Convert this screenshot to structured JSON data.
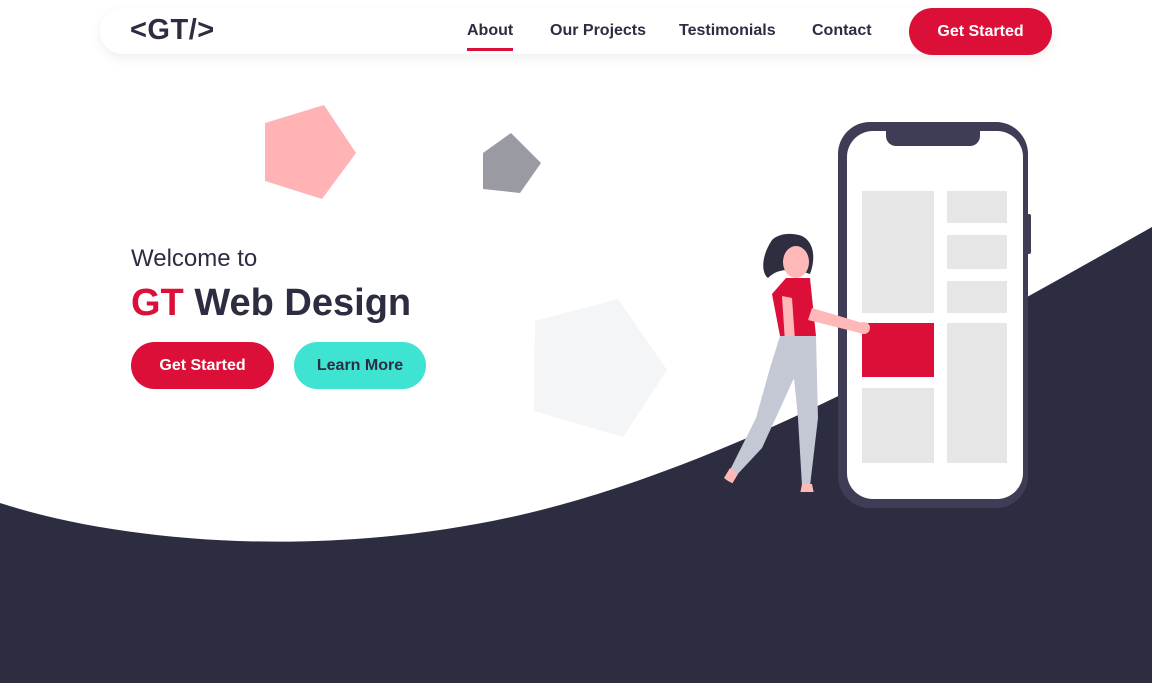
{
  "nav": {
    "logo": "<GT/>",
    "links": [
      "About",
      "Our Projects",
      "Testimonials",
      "Contact"
    ],
    "active": "About",
    "cta_label": "Get Started"
  },
  "hero": {
    "welcome": "Welcome to",
    "title_accent": "GT",
    "title_rest": "Web Design",
    "primary_button": "Get Started",
    "secondary_button": "Learn More"
  },
  "colors": {
    "accent": "#db0f38",
    "dark": "#2d2d42",
    "teal": "#3fe3d1",
    "pink_shape": "#ffb3b4",
    "gray_shape": "#9a9aa2"
  },
  "icons": [
    "pentagon-pink",
    "pentagon-gray",
    "pentagon-faint",
    "person-illustration",
    "phone-illustration"
  ]
}
